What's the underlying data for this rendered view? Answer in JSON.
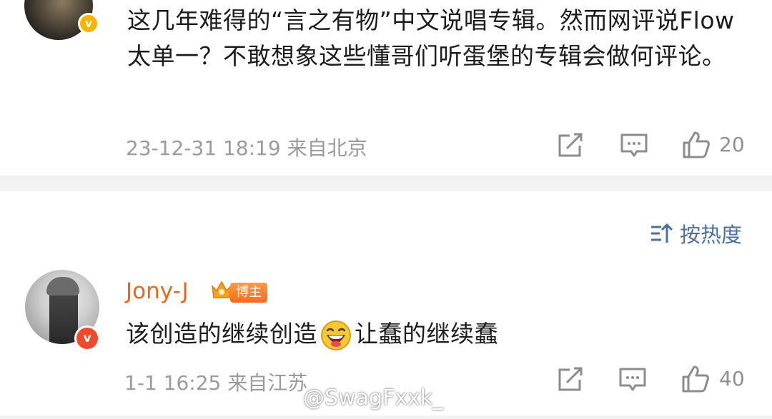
{
  "comment1": {
    "text": "这几年难得的“言之有物”中文说唱专辑。然而网评说Flow太单一？不敢想象这些懂哥们听蛋堡的专辑会做何评论。",
    "meta": "23-12-31 18:19  来自北京",
    "like_count": "20"
  },
  "sort": {
    "label": "按热度"
  },
  "comment2": {
    "username": "Jony-J",
    "badge": "博主",
    "text_before": "该创造的继续创造",
    "text_after": "让蠢的继续蠢",
    "meta": "1-1 16:25  来自江苏",
    "like_count": "40"
  },
  "watermark": "@SwagFxxk_",
  "colors": {
    "username": "#e8681c",
    "link_blue": "#4a6f9c",
    "meta_gray": "#9b9b9b",
    "verified_gold": "#f7b500",
    "verified_red": "#ef4a2b"
  },
  "icons": [
    "share-icon",
    "comment-icon",
    "like-icon",
    "sort-icon",
    "crown-icon",
    "laughing-emoji"
  ]
}
